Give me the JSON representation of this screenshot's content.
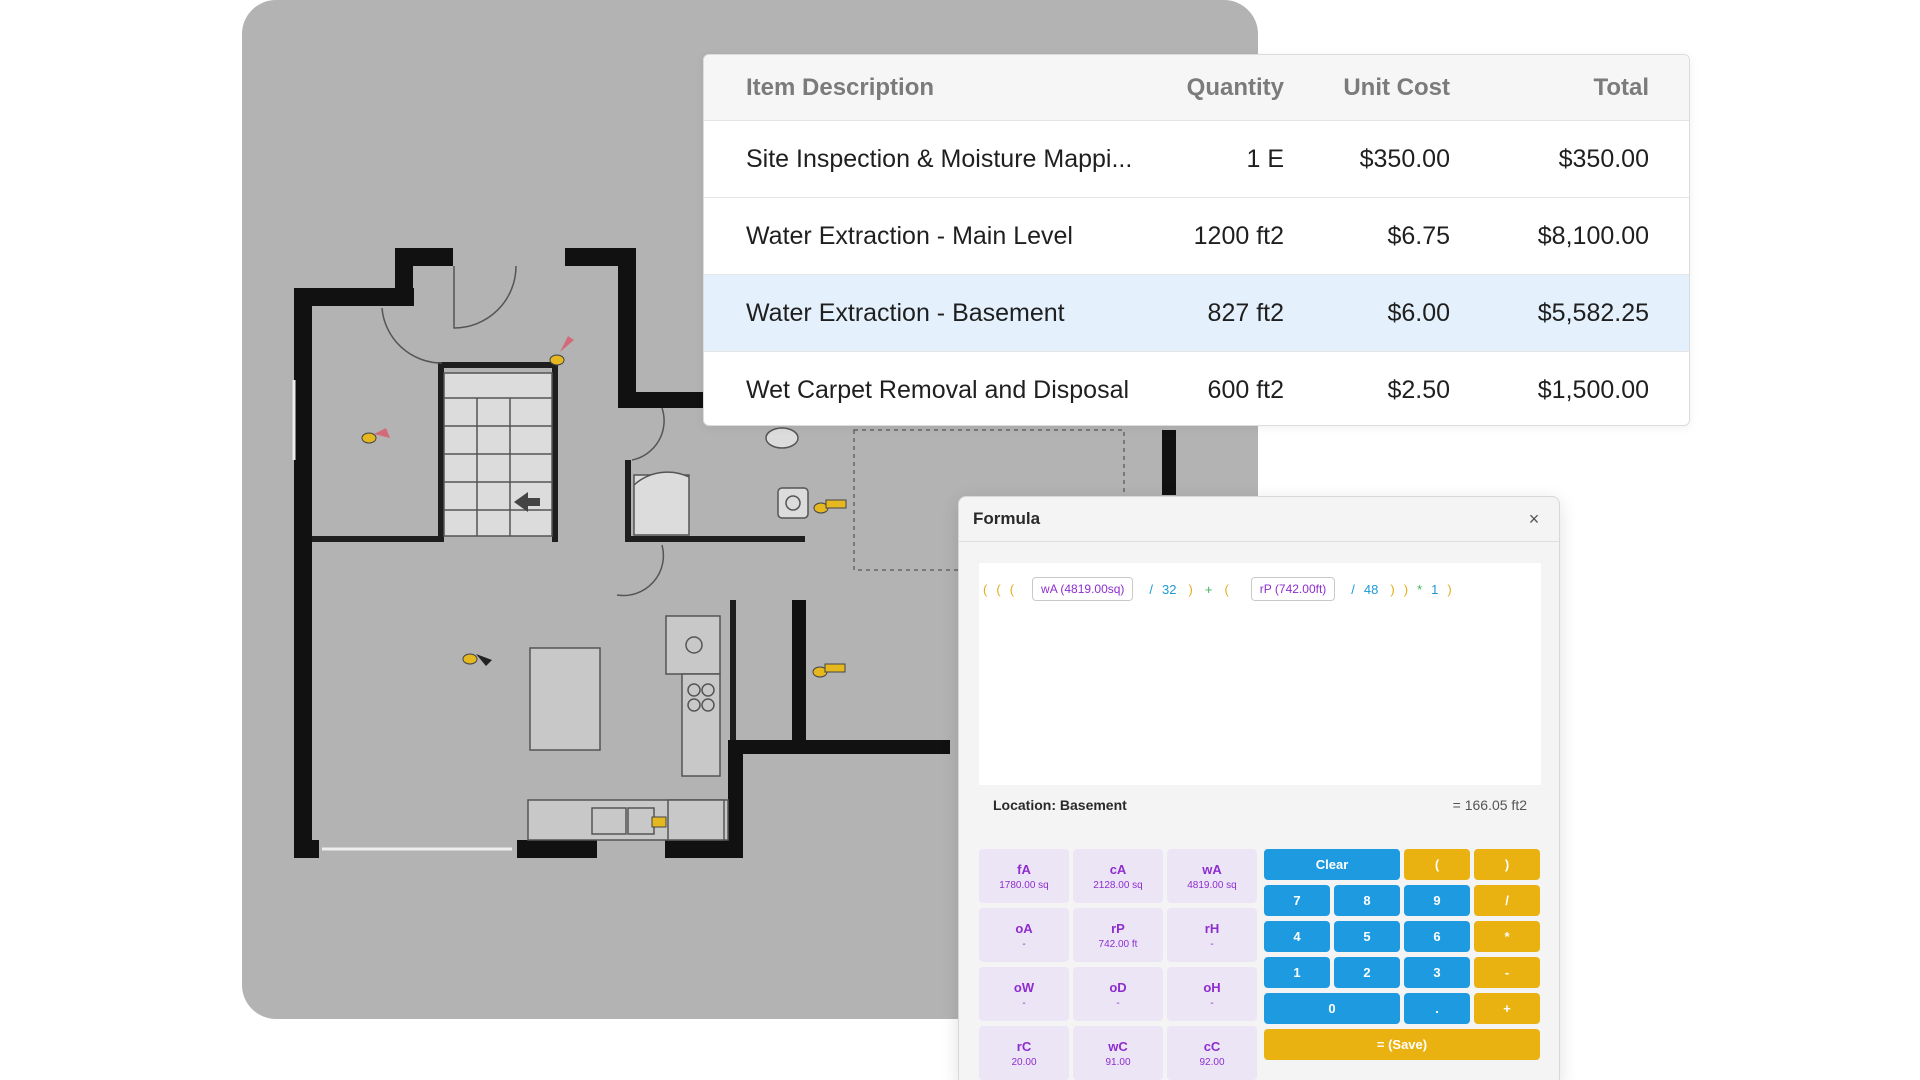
{
  "estimate": {
    "headers": {
      "description": "Item Description",
      "quantity": "Quantity",
      "unit_cost": "Unit Cost",
      "total": "Total"
    },
    "rows": [
      {
        "description": "Site Inspection & Moisture Mappi...",
        "quantity": "1 E",
        "unit_cost": "$350.00",
        "total": "$350.00",
        "selected": false
      },
      {
        "description": "Water Extraction - Main Level",
        "quantity": "1200 ft2",
        "unit_cost": "$6.75",
        "total": "$8,100.00",
        "selected": false
      },
      {
        "description": "Water Extraction - Basement",
        "quantity": "827 ft2",
        "unit_cost": "$6.00",
        "total": "$5,582.25",
        "selected": true
      },
      {
        "description": "Wet Carpet Removal and Disposal",
        "quantity": "600 ft2",
        "unit_cost": "$2.50",
        "total": "$1,500.00",
        "selected": false
      }
    ]
  },
  "formula": {
    "title": "Formula",
    "close_label": "×",
    "tokens": {
      "p1": "(",
      "p2": "(",
      "p3": "(",
      "chip1": "wA (4819.00sq)",
      "div1": "/",
      "n32": "32",
      "p4": ")",
      "plus": "+",
      "p5": "(",
      "chip2": "rP (742.00ft)",
      "div2": "/",
      "n48": "48",
      "p6": ")",
      "p7": ")",
      "mul": "*",
      "n1": "1",
      "p8": ")"
    },
    "location_label": "Location: Basement",
    "result": "= 166.05 ft2",
    "variables": [
      {
        "code": "fA",
        "value": "1780.00 sq"
      },
      {
        "code": "cA",
        "value": "2128.00 sq"
      },
      {
        "code": "wA",
        "value": "4819.00 sq"
      },
      {
        "code": "oA",
        "value": "-"
      },
      {
        "code": "rP",
        "value": "742.00 ft"
      },
      {
        "code": "rH",
        "value": "-"
      },
      {
        "code": "oW",
        "value": "-"
      },
      {
        "code": "oD",
        "value": "-"
      },
      {
        "code": "oH",
        "value": "-"
      },
      {
        "code": "rC",
        "value": "20.00"
      },
      {
        "code": "wC",
        "value": "91.00"
      },
      {
        "code": "cC",
        "value": "92.00"
      }
    ],
    "keys": {
      "clear": "Clear",
      "lparen": "(",
      "rparen": ")",
      "k7": "7",
      "k8": "8",
      "k9": "9",
      "div": "/",
      "k4": "4",
      "k5": "5",
      "k6": "6",
      "mul": "*",
      "k1": "1",
      "k2": "2",
      "k3": "3",
      "minus": "-",
      "k0": "0",
      "dot": ".",
      "plus": "+",
      "save": "= (Save)"
    },
    "colors": {
      "variable_text": "#8e2dcf",
      "key_blue": "#1e9be0",
      "key_yellow": "#eab210",
      "selected_row": "#e4f0fb"
    }
  },
  "floor_plan": {
    "icons": [
      "equipment-fan-icon",
      "equipment-fan-icon",
      "equipment-fan-icon",
      "equipment-fan-icon",
      "equipment-dehumidifier-icon",
      "equipment-dehumidifier-icon"
    ]
  }
}
